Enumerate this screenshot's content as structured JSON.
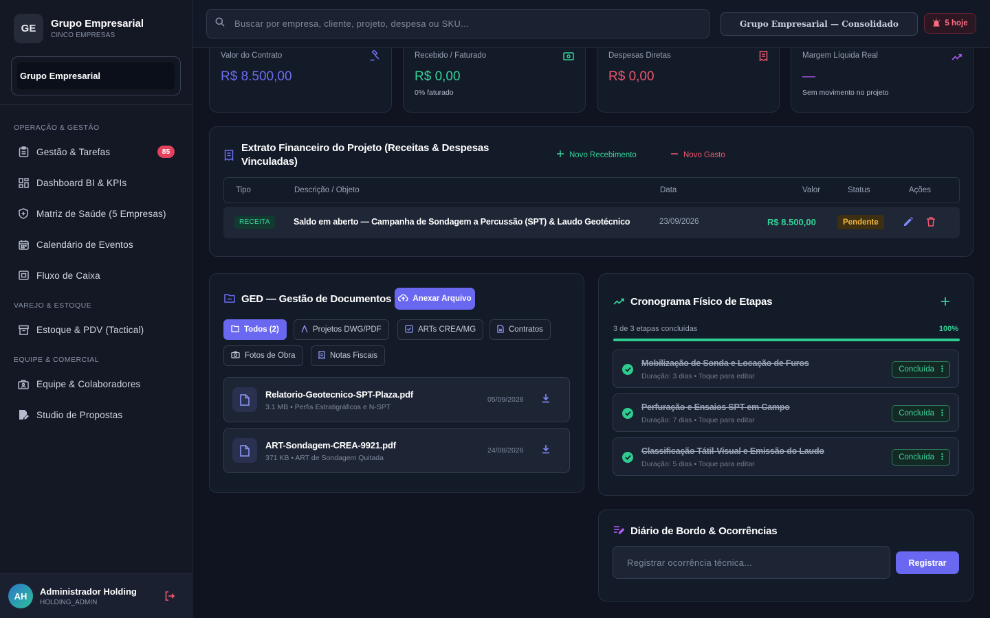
{
  "brand": {
    "initials": "GE",
    "name": "Grupo Empresarial",
    "subtitle": "CINCO EMPRESAS"
  },
  "company_selector": {
    "value": "Grupo Empresarial"
  },
  "nav": {
    "section_ops": "OPERAÇÃO & GESTÃO",
    "section_retail": "VAREJO & ESTOQUE",
    "section_team": "EQUIPE & COMERCIAL",
    "items": [
      {
        "label": "Gestão & Tarefas",
        "icon": "clipboard-icon",
        "badge": "85"
      },
      {
        "label": "Dashboard BI & KPIs",
        "icon": "dashboard-icon"
      },
      {
        "label": "Matriz de Saúde (5 Empresas)",
        "icon": "shield-icon"
      },
      {
        "label": "Calendário de Eventos",
        "icon": "calendar-icon"
      },
      {
        "label": "Fluxo de Caixa",
        "icon": "cashflow-icon"
      },
      {
        "label": "Estoque & PDV (Tactical)",
        "icon": "inventory-icon"
      },
      {
        "label": "Equipe & Colaboradores",
        "icon": "team-icon"
      },
      {
        "label": "Studio de Propostas",
        "icon": "proposal-icon"
      }
    ]
  },
  "user": {
    "initials": "AH",
    "name": "Administrador Holding",
    "role": "HOLDING_ADMIN"
  },
  "topbar": {
    "search_placeholder": "Buscar por empresa, cliente, projeto, despesa ou SKU...",
    "scope": "Grupo Empresarial — Consolidado",
    "alerts": "5 hoje"
  },
  "kpis": [
    {
      "title": "Valor do Contrato",
      "value": "R$ 8.500,00",
      "sub": "",
      "color": "#6d6cf2",
      "icon": "gavel-icon"
    },
    {
      "title": "Recebido / Faturado",
      "value": "R$ 0,00",
      "sub": "0% faturado",
      "color": "#35d399",
      "icon": "money-icon"
    },
    {
      "title": "Despesas Diretas",
      "value": "R$ 0,00",
      "sub": "",
      "color": "#f0586d",
      "icon": "receipt-icon"
    },
    {
      "title": "Margem Líquida Real",
      "value": "—",
      "sub": "Sem movimento no projeto",
      "color": "#b05cf0",
      "icon": "trend-icon"
    }
  ],
  "extrato": {
    "title_line1": "Extrato Financeiro do Projeto (Receitas & Despesas",
    "title_line2": "Vinculadas)",
    "new_income": "Novo Recebimento",
    "new_expense": "Novo Gasto",
    "columns": {
      "tipo": "Tipo",
      "descricao": "Descrição / Objeto",
      "data": "Data",
      "valor": "Valor",
      "status": "Status",
      "acoes": "Ações"
    },
    "rows": [
      {
        "tipo": "RECEITA",
        "descricao": "Saldo em aberto — Campanha de Sondagem a Percussão (SPT) & Laudo Geotécnico",
        "data": "23/09/2026",
        "valor": "R$ 8.500,00",
        "status": "Pendente"
      }
    ]
  },
  "ged": {
    "title": "GED — Gestão de Documentos",
    "attach": "Anexar Arquivo",
    "filters": [
      "Todos (2)",
      "Projetos DWG/PDF",
      "ARTs CREA/MG",
      "Contratos",
      "Fotos de Obra",
      "Notas Fiscais"
    ],
    "files": [
      {
        "name": "Relatorio-Geotecnico-SPT-Plaza.pdf",
        "meta": "3.1 MB • Perfis Estratigráficos e N-SPT",
        "date": "05/09/2026"
      },
      {
        "name": "ART-Sondagem-CREA-9921.pdf",
        "meta": "371 KB • ART de Sondagem Quitada",
        "date": "24/08/2026"
      }
    ]
  },
  "cronograma": {
    "title": "Cronograma Físico de Etapas",
    "progress_text": "3 de 3 etapas concluídas",
    "progress_pct": "100%",
    "progress_value": 1.0,
    "stages": [
      {
        "name": "Mobilização de Sonda e Locação de Furos",
        "meta": "Duração: 3 dias • Toque para editar",
        "status": "Concluída"
      },
      {
        "name": "Perfuração e Ensaios SPT em Campo",
        "meta": "Duração: 7 dias • Toque para editar",
        "status": "Concluída"
      },
      {
        "name": "Classificação Tátil-Visual e Emissão do Laudo",
        "meta": "Duração: 5 dias • Toque para editar",
        "status": "Concluída"
      }
    ]
  },
  "diario": {
    "title": "Diário de Bordo & Ocorrências",
    "placeholder": "Registrar ocorrência técnica...",
    "button": "Registrar"
  }
}
